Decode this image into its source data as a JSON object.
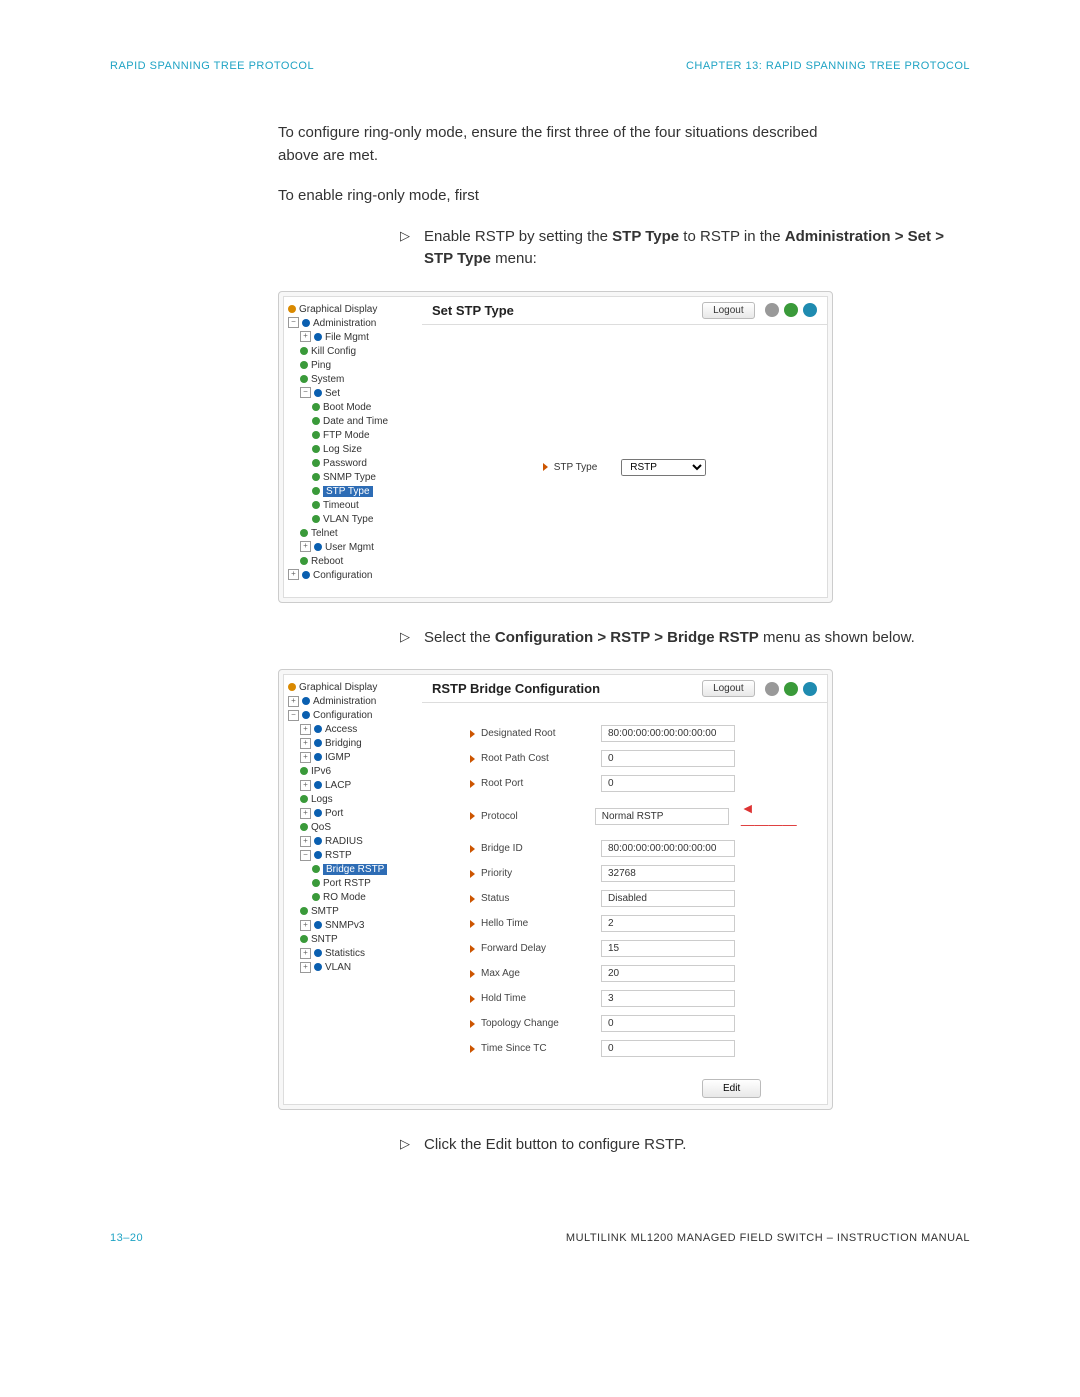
{
  "header": {
    "left": "RAPID SPANNING TREE PROTOCOL",
    "right": "CHAPTER 13: RAPID SPANNING TREE PROTOCOL"
  },
  "intro": {
    "p1": "To configure ring-only mode, ensure the first three of the four situations described above are met.",
    "p2": "To enable ring-only mode, first"
  },
  "step1": {
    "pre": "Enable RSTP by setting the ",
    "b1": "STP Type",
    "mid": " to RSTP in the ",
    "b2": "Administration > Set > STP Type",
    "post": " menu:"
  },
  "step2": {
    "pre": "Select the ",
    "b1": "Configuration > RSTP > Bridge RSTP",
    "post": " menu as shown below."
  },
  "step3": {
    "pre": "Click the Edit button to configure RSTP."
  },
  "screenshot1": {
    "title": "Set STP Type",
    "logout": "Logout",
    "tree": {
      "graphical": "Graphical Display",
      "admin": "Administration",
      "file_mgmt": "File Mgmt",
      "kill_config": "Kill Config",
      "ping": "Ping",
      "system": "System",
      "set": "Set",
      "boot_mode": "Boot Mode",
      "date_time": "Date and Time",
      "ftp_mode": "FTP Mode",
      "log_size": "Log Size",
      "password": "Password",
      "snmp_type": "SNMP Type",
      "stp_type": "STP Type",
      "timeout": "Timeout",
      "vlan_type": "VLAN Type",
      "telnet": "Telnet",
      "user_mgmt": "User Mgmt",
      "reboot": "Reboot",
      "configuration": "Configuration"
    },
    "field_label": "STP Type",
    "field_value": "RSTP"
  },
  "screenshot2": {
    "title": "RSTP Bridge Configuration",
    "logout": "Logout",
    "edit": "Edit",
    "tree": {
      "graphical": "Graphical Display",
      "admin": "Administration",
      "config": "Configuration",
      "access": "Access",
      "bridging": "Bridging",
      "igmp": "IGMP",
      "ipv6": "IPv6",
      "lacp": "LACP",
      "logs": "Logs",
      "port": "Port",
      "qos": "QoS",
      "radius": "RADIUS",
      "rstp": "RSTP",
      "bridge_rstp": "Bridge RSTP",
      "port_rstp": "Port RSTP",
      "ro_mode": "RO Mode",
      "smtp": "SMTP",
      "snmpv3": "SNMPv3",
      "sntp": "SNTP",
      "statistics": "Statistics",
      "vlan": "VLAN"
    },
    "fields": [
      {
        "label": "Designated Root",
        "value": "80:00:00:00:00:00:00:00"
      },
      {
        "label": "Root Path Cost",
        "value": "0"
      },
      {
        "label": "Root Port",
        "value": "0"
      },
      {
        "label": "Protocol",
        "value": "Normal RSTP",
        "arrow": true
      },
      {
        "label": "Bridge ID",
        "value": "80:00:00:00:00:00:00:00"
      },
      {
        "label": "Priority",
        "value": "32768"
      },
      {
        "label": "Status",
        "value": "Disabled"
      },
      {
        "label": "Hello Time",
        "value": "2"
      },
      {
        "label": "Forward Delay",
        "value": "15"
      },
      {
        "label": "Max Age",
        "value": "20"
      },
      {
        "label": "Hold Time",
        "value": "3"
      },
      {
        "label": "Topology Change",
        "value": "0"
      },
      {
        "label": "Time Since TC",
        "value": "0"
      }
    ]
  },
  "footer": {
    "left": "13–20",
    "right": "MULTILINK ML1200 MANAGED FIELD SWITCH – INSTRUCTION MANUAL"
  }
}
